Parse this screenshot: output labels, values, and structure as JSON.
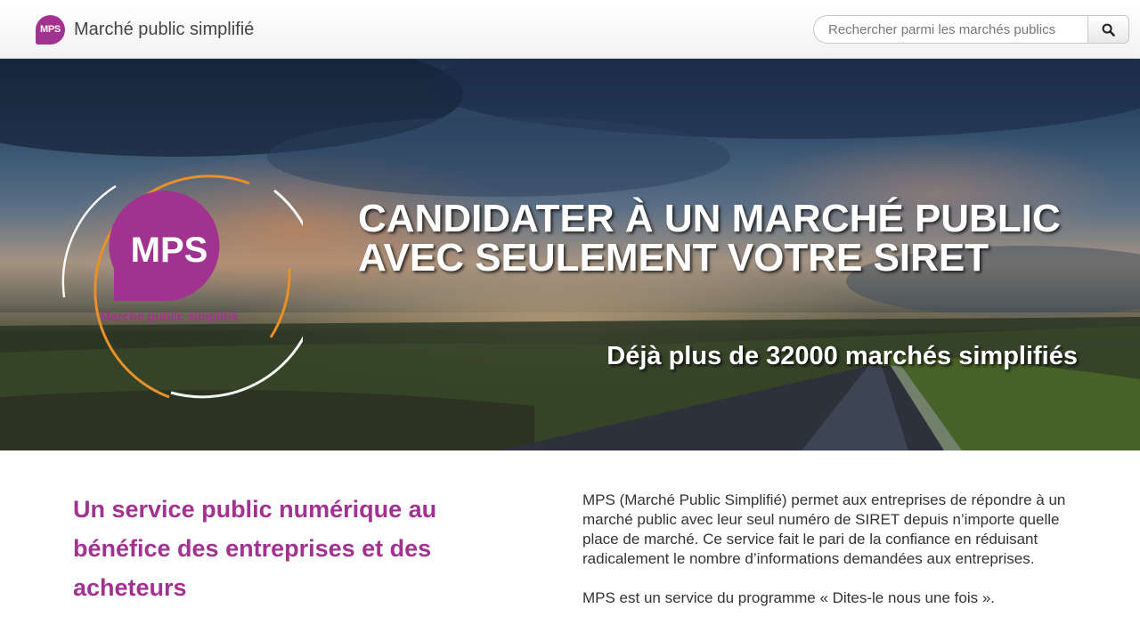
{
  "header": {
    "brand_logo_text": "MPS",
    "brand_name": "Marché public simplifié",
    "search_placeholder": "Rechercher parmi les marchés publics",
    "search_icon": "search-icon"
  },
  "hero": {
    "logo_text": "MPS",
    "logo_caption": "Marché public simplifié",
    "title": "CANDIDATER À UN MARCHÉ PUBLIC AVEC SEULEMENT VOTRE SIRET",
    "subtitle": "Déjà plus de 32000 marchés simplifiés"
  },
  "intro": {
    "heading": "Un service public numérique au bénéfice des entreprises et des acheteurs",
    "paragraph1": "MPS (Marché Public Simplifié) permet aux entreprises de répondre à un marché public avec leur seul numéro de SIRET depuis n’importe quelle place de marché. Ce service fait le pari de la confiance en réduisant radicalement le nombre d’informations demandées aux entreprises.",
    "paragraph2": "MPS est un service du programme « Dites-le nous une fois »."
  },
  "colors": {
    "brand_purple": "#a2328f",
    "ring_orange": "#e8902a"
  }
}
